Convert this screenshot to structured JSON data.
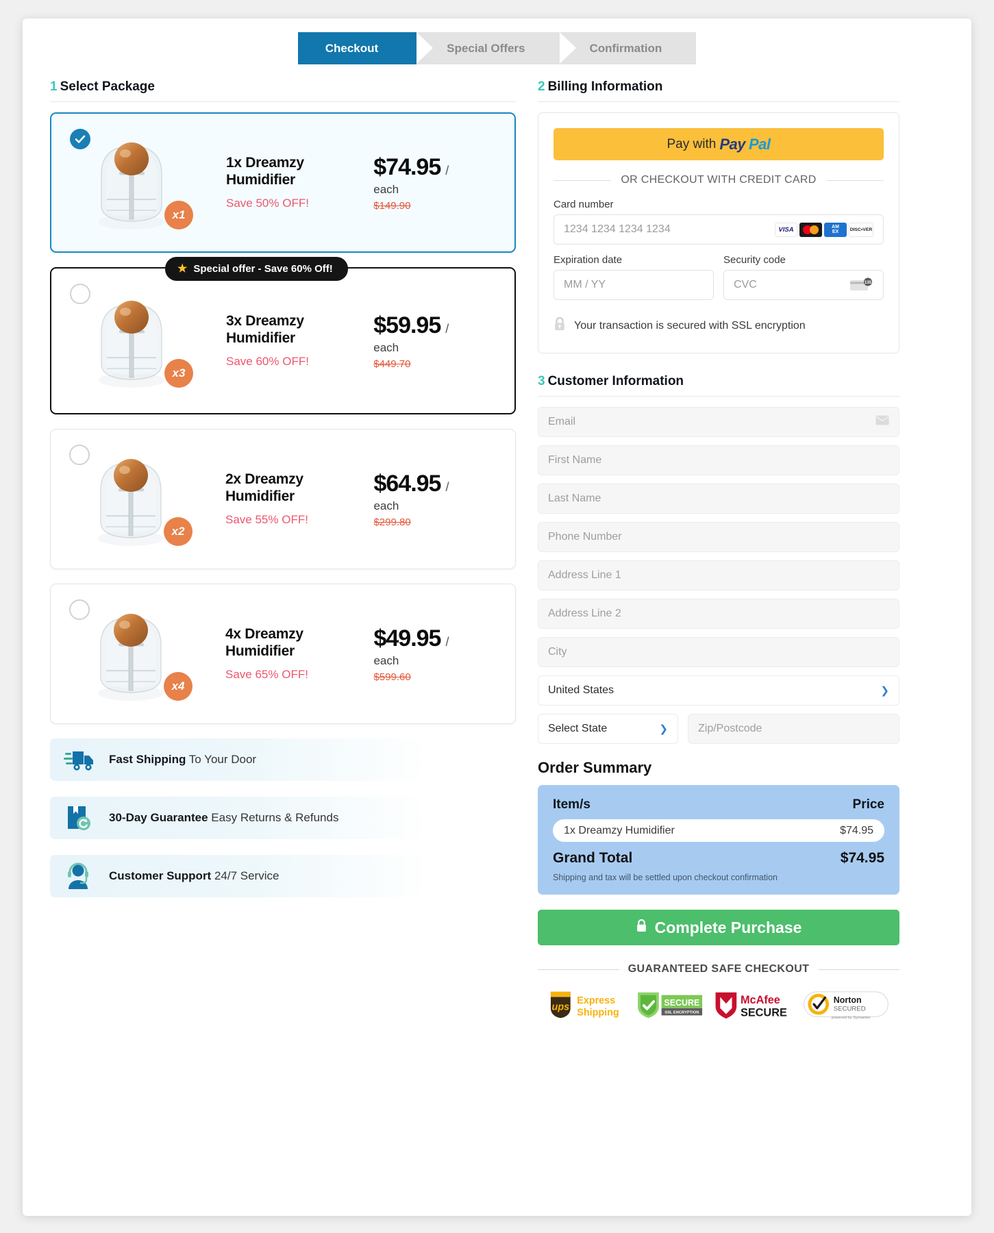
{
  "steps": [
    {
      "label": "Checkout",
      "state": "active"
    },
    {
      "label": "Special Offers",
      "state": "inactive"
    },
    {
      "label": "Confirmation",
      "state": "inactive"
    }
  ],
  "select_package": {
    "number": "1",
    "title": "Select Package",
    "packages": [
      {
        "title": "1x Dreamzy Humidifier",
        "save": "Save 50% OFF!",
        "price": "$74.95",
        "slash": "/",
        "each": "each",
        "old_price": "$149.90",
        "qty_badge": "x1",
        "selected": true,
        "offer_badge": null
      },
      {
        "title": "3x Dreamzy Humidifier",
        "save": "Save 60% OFF!",
        "price": "$59.95",
        "slash": "/",
        "each": "each",
        "old_price": "$449.70",
        "qty_badge": "x3",
        "selected": false,
        "offer_badge": "Special offer - Save 60% Off!"
      },
      {
        "title": "2x Dreamzy Humidifier",
        "save": "Save 55% OFF!",
        "price": "$64.95",
        "slash": "/",
        "each": "each",
        "old_price": "$299.80",
        "qty_badge": "x2",
        "selected": false,
        "offer_badge": null
      },
      {
        "title": "4x Dreamzy Humidifier",
        "save": "Save 65% OFF!",
        "price": "$49.95",
        "slash": "/",
        "each": "each",
        "old_price": "$599.60",
        "qty_badge": "x4",
        "selected": false,
        "offer_badge": null
      }
    ]
  },
  "benefits": [
    {
      "icon": "shipping-truck-icon",
      "bold": "Fast Shipping",
      "rest": " To Your Door"
    },
    {
      "icon": "return-box-icon",
      "bold": "30-Day Guarantee",
      "rest": " Easy Returns & Refunds"
    },
    {
      "icon": "support-agent-icon",
      "bold": "Customer Support",
      "rest": " 24/7 Service"
    }
  ],
  "billing": {
    "number": "2",
    "title": "Billing Information",
    "paypal_pay_with": "Pay with",
    "paypal_pay": "Pay",
    "paypal_pal": "Pal",
    "divider": "OR CHECKOUT WITH CREDIT CARD",
    "card_number_label": "Card number",
    "card_number_placeholder": "1234 1234 1234 1234",
    "expiry_label": "Expiration date",
    "expiry_placeholder": "MM / YY",
    "cvc_label": "Security code",
    "cvc_placeholder": "CVC",
    "cvc_hint": "135",
    "card_brands": [
      "VISA",
      "Mastercard",
      "AMEX",
      "DISCOVER"
    ],
    "amex_line1": "AM",
    "amex_line2": "EX",
    "discover_label": "DISC•VER",
    "ssl_note": "Your transaction is secured with SSL encryption"
  },
  "customer": {
    "number": "3",
    "title": "Customer Information",
    "fields": [
      {
        "name": "email",
        "placeholder": "Email",
        "value": "",
        "icon": "envelope-icon"
      },
      {
        "name": "first-name",
        "placeholder": "First Name",
        "value": ""
      },
      {
        "name": "last-name",
        "placeholder": "Last Name",
        "value": ""
      },
      {
        "name": "phone",
        "placeholder": "Phone Number",
        "value": ""
      },
      {
        "name": "address-1",
        "placeholder": "Address Line 1",
        "value": ""
      },
      {
        "name": "address-2",
        "placeholder": "Address Line 2",
        "value": ""
      },
      {
        "name": "city",
        "placeholder": "City",
        "value": ""
      }
    ],
    "country_value": "United States",
    "state_value": "Select State",
    "zip_placeholder": "Zip/Postcode"
  },
  "order_summary": {
    "title": "Order Summary",
    "col_item": "Item/s",
    "col_price": "Price",
    "items": [
      {
        "name": "1x Dreamzy Humidifier",
        "price": "$74.95"
      }
    ],
    "total_label": "Grand Total",
    "total_value": "$74.95",
    "note": "Shipping and tax will be settled upon checkout confirmation",
    "buy_label": "Complete Purchase"
  },
  "footer": {
    "safe_title": "GUARANTEED SAFE CHECKOUT",
    "badges": [
      {
        "name": "ups-express-shipping-badge",
        "l1": "Express",
        "l2": "Shipping",
        "mark": "ups"
      },
      {
        "name": "ssl-secure-badge",
        "l1": "SECURE",
        "l2": "SSL ENCRYPTION"
      },
      {
        "name": "mcafee-secure-badge",
        "l1": "McAfee",
        "l2": "SECURE"
      },
      {
        "name": "norton-secured-badge",
        "l1": "Norton",
        "l2": "SECURED",
        "l3": "powered by Symantec"
      }
    ]
  },
  "colors": {
    "accent_blue": "#1177ad",
    "selected_border": "#1a87c0",
    "teal_number": "#3cc8b4",
    "save_pink": "#ee566e",
    "old_price": "#e4583c",
    "qty_orange": "#e8814a",
    "paypal_yellow": "#fbbf3a",
    "buy_green": "#4cbe6c",
    "summary_blue": "#a7cbf0"
  }
}
